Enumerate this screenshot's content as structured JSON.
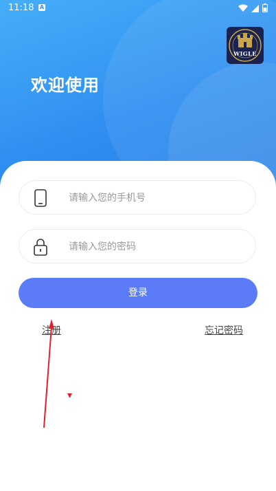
{
  "status_bar": {
    "time": "11:18",
    "badge": "A"
  },
  "logo": {
    "text": "WIGLE"
  },
  "header": {
    "title": "欢迎使用"
  },
  "form": {
    "phone_placeholder": "请输入您的手机号",
    "password_placeholder": "请输入您的密码",
    "login_label": "登录"
  },
  "links": {
    "register": "注册",
    "forgot": "忘记密码"
  },
  "colors": {
    "header": "#2f8ef0",
    "button": "#5b7cf6",
    "gesture": "#e0202a"
  }
}
